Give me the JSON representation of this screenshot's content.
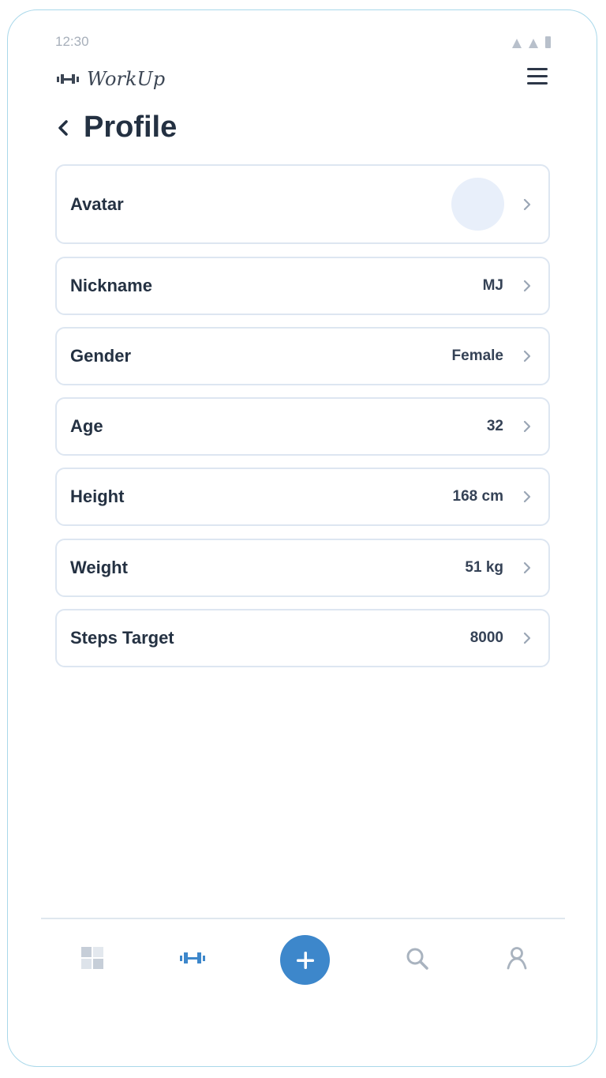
{
  "status_bar": {
    "time": "12:30"
  },
  "app": {
    "name": "WorkUp",
    "logo_icon": "dumbbell-icon",
    "menu_icon": "hamburger-menu-icon"
  },
  "header": {
    "title": "Profile",
    "back_icon": "chevron-left-icon"
  },
  "profile": {
    "avatar": {
      "label": "Avatar"
    },
    "nickname": {
      "label": "Nickname",
      "value": "MJ"
    },
    "gender": {
      "label": "Gender",
      "value": "Female"
    },
    "age": {
      "label": "Age",
      "value": "32"
    },
    "height": {
      "label": "Height",
      "value": "168 cm"
    },
    "weight": {
      "label": "Weight",
      "value": "51 kg"
    },
    "steps_target": {
      "label": "Steps Target",
      "value": "8000"
    }
  },
  "bottom_nav": {
    "items": [
      {
        "icon": "dashboard-grid-icon"
      },
      {
        "icon": "dumbbell-icon",
        "active": true
      },
      {
        "icon": "plus-icon"
      },
      {
        "icon": "search-icon"
      },
      {
        "icon": "user-icon"
      }
    ]
  },
  "colors": {
    "accent": "#3d87cb",
    "text_primary": "#243142",
    "card_border": "#dde6f1",
    "avatar_bg": "#e8effa",
    "frame_border": "#a9d8ea",
    "muted": "#a7afba"
  }
}
